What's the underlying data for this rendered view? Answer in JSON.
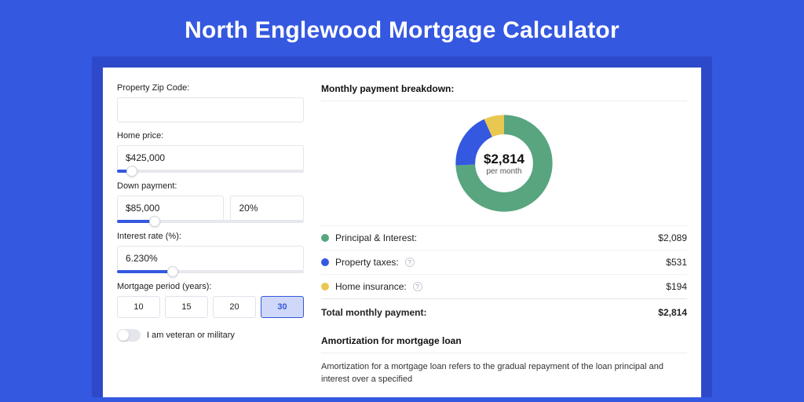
{
  "brand_color": "#3458e0",
  "hero": {
    "title": "North Englewood Mortgage Calculator"
  },
  "form": {
    "zip": {
      "label": "Property Zip Code:",
      "value": ""
    },
    "price": {
      "label": "Home price:",
      "value": "$425,000",
      "slider_pct": 8
    },
    "down": {
      "label": "Down payment:",
      "value": "$85,000",
      "pct": "20%",
      "slider_pct": 20
    },
    "rate": {
      "label": "Interest rate (%):",
      "value": "6.230%",
      "slider_pct": 30
    },
    "period": {
      "label": "Mortgage period (years):",
      "options": [
        "10",
        "15",
        "20",
        "30"
      ],
      "selected": "30"
    },
    "veteran": {
      "label": "I am veteran or military",
      "on": false
    }
  },
  "breakdown": {
    "title": "Monthly payment breakdown:",
    "center_value": "$2,814",
    "center_sub": "per month",
    "items": [
      {
        "key": "pi",
        "label": "Principal & Interest:",
        "amount": "$2,089",
        "color": "#58a580",
        "help": false
      },
      {
        "key": "tax",
        "label": "Property taxes:",
        "amount": "$531",
        "color": "#3458e0",
        "help": true
      },
      {
        "key": "ins",
        "label": "Home insurance:",
        "amount": "$194",
        "color": "#e9c851",
        "help": true
      }
    ],
    "total_label": "Total monthly payment:",
    "total_amount": "$2,814"
  },
  "amort": {
    "title": "Amortization for mortgage loan",
    "text": "Amortization for a mortgage loan refers to the gradual repayment of the loan principal and interest over a specified"
  },
  "chart_data": {
    "type": "pie",
    "title": "Monthly payment breakdown",
    "series": [
      {
        "name": "Principal & Interest",
        "value": 2089,
        "color": "#58a580"
      },
      {
        "name": "Property taxes",
        "value": 531,
        "color": "#3458e0"
      },
      {
        "name": "Home insurance",
        "value": 194,
        "color": "#e9c851"
      }
    ],
    "total": 2814,
    "unit": "USD per month",
    "hole": 0.62
  }
}
